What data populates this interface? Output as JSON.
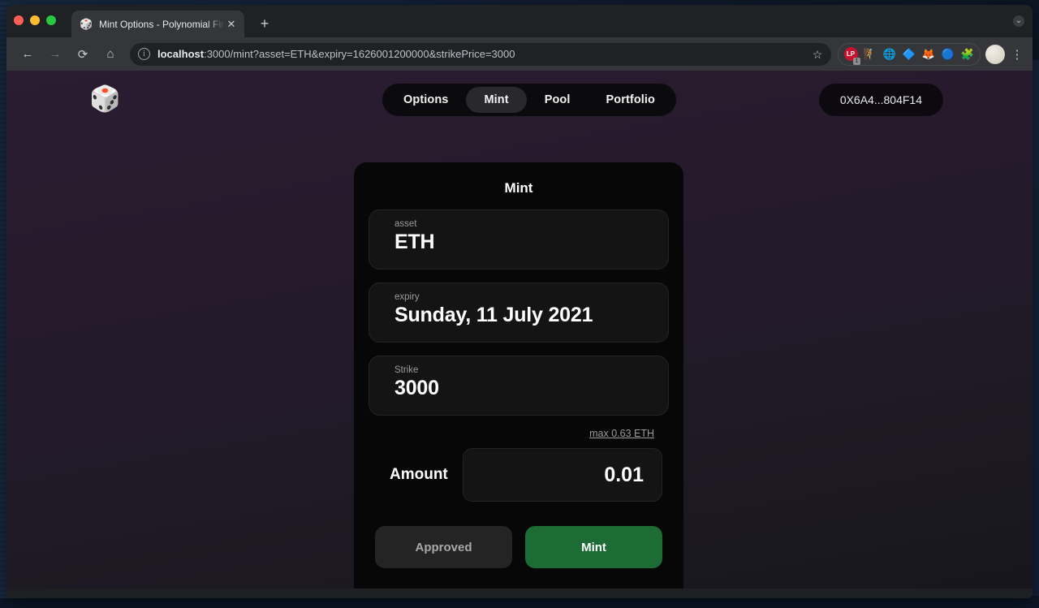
{
  "desktop": {
    "bg_fragments": [
      "io",
      "s",
      "m"
    ]
  },
  "browser": {
    "traffic_lights": [
      "close",
      "minimize",
      "maximize"
    ],
    "tab": {
      "favicon": "🎲",
      "title": "Mint Options - Polynomial Fina",
      "close_label": "✕"
    },
    "new_tab_label": "+",
    "tabstrip_right_label": "⌄",
    "toolbar": {
      "back_label": "←",
      "forward_label": "→",
      "reload_label": "⟳",
      "home_label": "⌂",
      "info_label": "i",
      "url_host": "localhost",
      "url_rest": ":3000/mint?asset=ETH&expiry=1626001200000&strikePrice=3000",
      "bookmark_label": "☆",
      "extensions": [
        {
          "name": "lastpass-extension",
          "glyph": "LP",
          "badge": "1"
        },
        {
          "name": "keplr-extension",
          "glyph": "🧗"
        },
        {
          "name": "phantom-extension",
          "glyph": "🌐"
        },
        {
          "name": "rabby-extension",
          "glyph": "🔷"
        },
        {
          "name": "metamask-extension",
          "glyph": "🦊"
        },
        {
          "name": "coinbase-wallet-extension",
          "glyph": "🔵"
        },
        {
          "name": "puzzle-extension",
          "glyph": "🧩"
        }
      ],
      "profile_label": "",
      "menu_label": "⋮"
    }
  },
  "app": {
    "logo": "🎲",
    "tabs": [
      {
        "label": "Options",
        "active": false
      },
      {
        "label": "Mint",
        "active": true
      },
      {
        "label": "Pool",
        "active": false
      },
      {
        "label": "Portfolio",
        "active": false
      }
    ],
    "wallet_address": "0X6A4...804F14",
    "card": {
      "title": "Mint",
      "fields": [
        {
          "label": "asset",
          "value": "ETH"
        },
        {
          "label": "expiry",
          "value": "Sunday, 11 July 2021"
        },
        {
          "label": "Strike",
          "value": "3000"
        }
      ],
      "max_link": "max 0.63 ETH",
      "amount_label": "Amount",
      "amount_value": "0.01",
      "approve_button": "Approved",
      "mint_button": "Mint"
    }
  },
  "colors": {
    "mint_green": "#1d6b35",
    "card_bg": "#070707",
    "field_bg": "#141414",
    "page_bg_top": "#2a1c31",
    "page_bg_bottom": "#17161c"
  }
}
